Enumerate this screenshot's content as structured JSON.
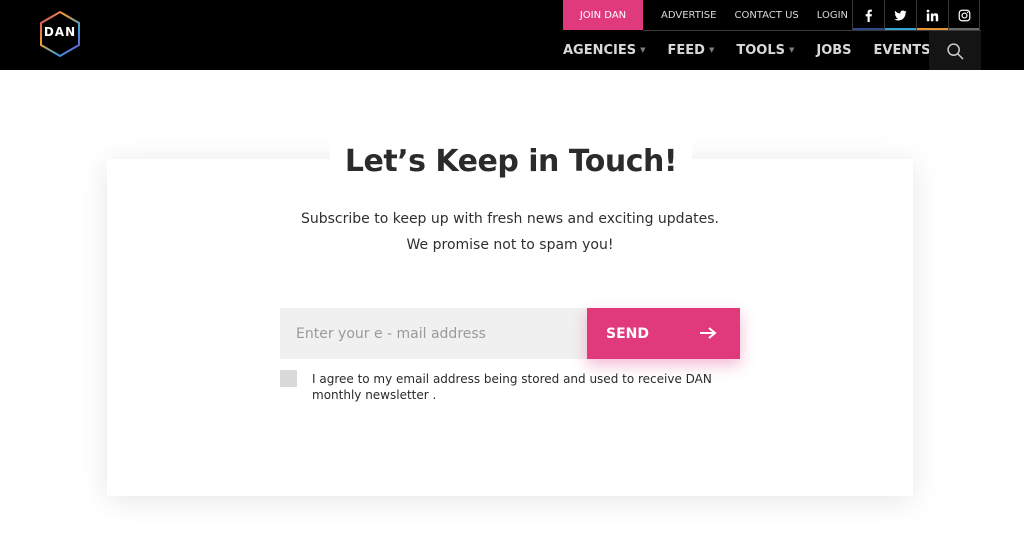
{
  "header": {
    "logo_text": "DAN",
    "join_label": "JOIN DAN",
    "top_links": [
      "ADVERTISE",
      "CONTACT US",
      "LOGIN"
    ],
    "social": [
      {
        "icon": "facebook-icon",
        "color": "#2d4a8a"
      },
      {
        "icon": "twitter-icon",
        "color": "#35a5d8"
      },
      {
        "icon": "linkedin-icon",
        "color": "#e59432"
      },
      {
        "icon": "instagram-icon",
        "color": "#6a6a6a"
      }
    ],
    "nav": [
      "AGENCIES",
      "FEED",
      "TOOLS",
      "JOBS",
      "EVENTS"
    ],
    "search_icon": "search-icon"
  },
  "newsletter": {
    "title": "Let’s Keep in Touch!",
    "subtitle_line1": "Subscribe to keep up with fresh news and exciting updates.",
    "subtitle_line2": "We promise not to spam you!",
    "email_placeholder": "Enter your e - mail address",
    "email_value": "",
    "send_label": "SEND",
    "consent_text": "I agree to my email address being stored and used to receive DAN monthly newsletter ."
  },
  "colors": {
    "accent": "#e03a7d",
    "header_bg": "#000000"
  }
}
